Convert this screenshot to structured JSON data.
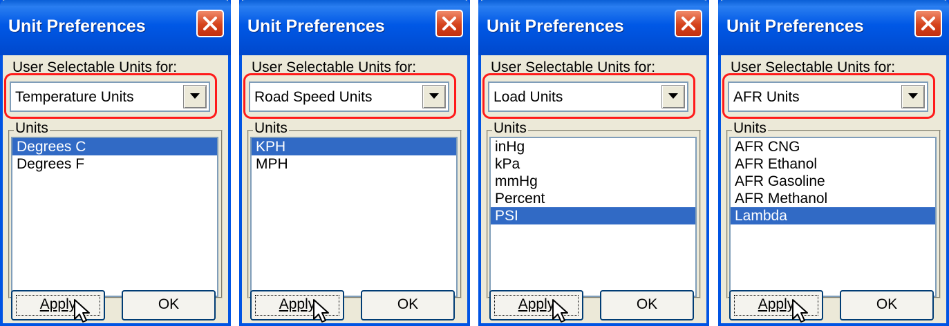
{
  "dialogs": [
    {
      "title": "Unit Preferences",
      "selector_label": "User Selectable Units for:",
      "selected_category": "Temperature Units",
      "units_label": "Units",
      "units": [
        "Degrees C",
        "Degrees F"
      ],
      "selected_unit": "Degrees C",
      "apply_label": "Apply",
      "ok_label": "OK"
    },
    {
      "title": "Unit Preferences",
      "selector_label": "User Selectable Units for:",
      "selected_category": "Road Speed Units",
      "units_label": "Units",
      "units": [
        "KPH",
        "MPH"
      ],
      "selected_unit": "KPH",
      "apply_label": "Apply",
      "ok_label": "OK"
    },
    {
      "title": "Unit Preferences",
      "selector_label": "User Selectable Units for:",
      "selected_category": "Load Units",
      "units_label": "Units",
      "units": [
        "inHg",
        "kPa",
        "mmHg",
        "Percent",
        "PSI"
      ],
      "selected_unit": "PSI",
      "apply_label": "Apply",
      "ok_label": "OK"
    },
    {
      "title": "Unit Preferences",
      "selector_label": "User Selectable Units for:",
      "selected_category": "AFR Units",
      "units_label": "Units",
      "units": [
        "AFR CNG",
        "AFR Ethanol",
        "AFR Gasoline",
        "AFR Methanol",
        "Lambda"
      ],
      "selected_unit": "Lambda",
      "apply_label": "Apply",
      "ok_label": "OK"
    }
  ],
  "colors": {
    "titlebar": "#0058e6",
    "dialog_bg": "#ece9d8",
    "selection": "#316ac5",
    "highlight_outline": "#ff1a1a",
    "close_button": "#d5431c"
  },
  "icons": [
    "close-icon",
    "dropdown-arrow-icon",
    "mouse-cursor-icon"
  ]
}
